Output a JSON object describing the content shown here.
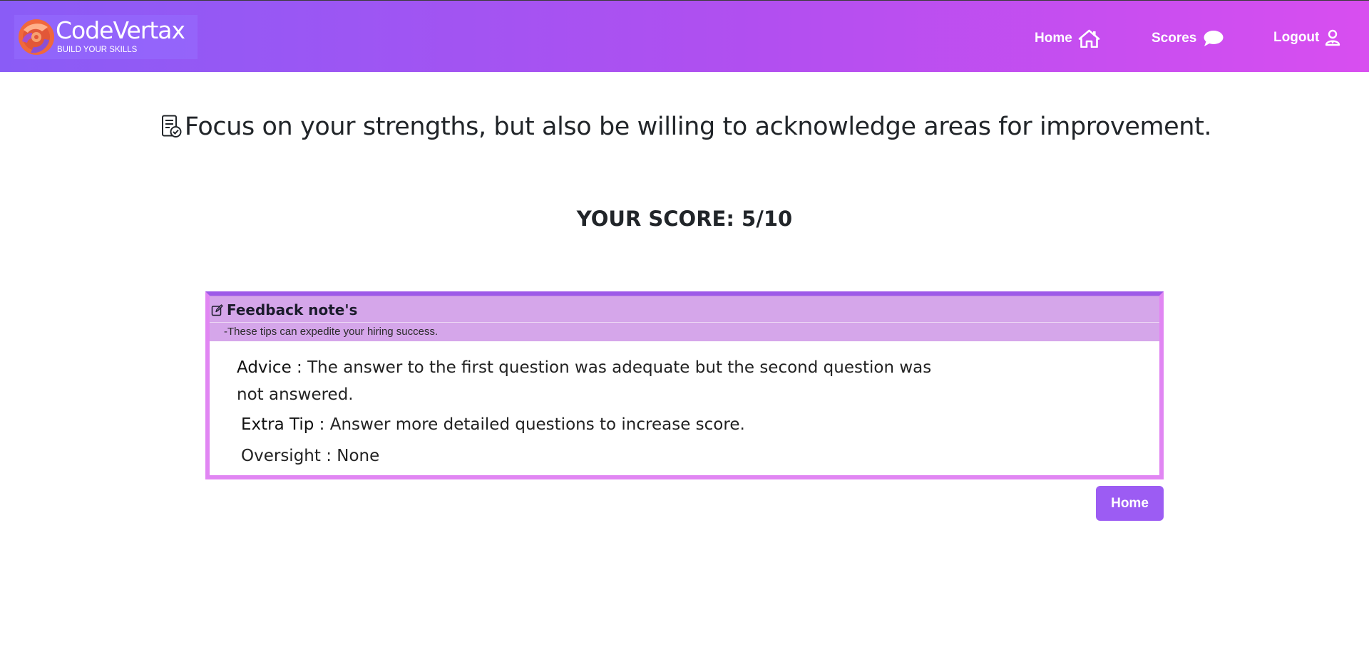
{
  "brand": {
    "name": "CodeVertax",
    "tagline": "BUILD YOUR SKILLS"
  },
  "nav": {
    "home": "Home",
    "scores": "Scores",
    "logout": "Logout"
  },
  "main": {
    "headline": "Focus on your strengths, but also be willing to acknowledge areas for improvement.",
    "score": "YOUR SCORE: 5/10"
  },
  "feedback": {
    "title": "Feedback note's",
    "subtitle": "-These tips can expedite your hiring success.",
    "advice_label": "Advice :",
    "advice_text": "The answer to the first question was adequate but the second question was not answered.",
    "extra_label": "Extra Tip :",
    "extra_text": "Answer more detailed questions to increase score.",
    "oversight": "Oversight : None"
  },
  "actions": {
    "home_button": "Home"
  },
  "colors": {
    "gradient_start": "#8a5cf6",
    "gradient_end": "#d84ef0",
    "button": "#9c5cf3",
    "card_header": "#d5a6ea",
    "card_border": "#e186f3"
  },
  "icons": {
    "logo": "codevertax-logo-icon",
    "home": "house-icon",
    "scores": "speech-bubble-icon",
    "logout": "user-icon",
    "headline": "clipboard-check-icon",
    "feedback": "edit-icon"
  }
}
